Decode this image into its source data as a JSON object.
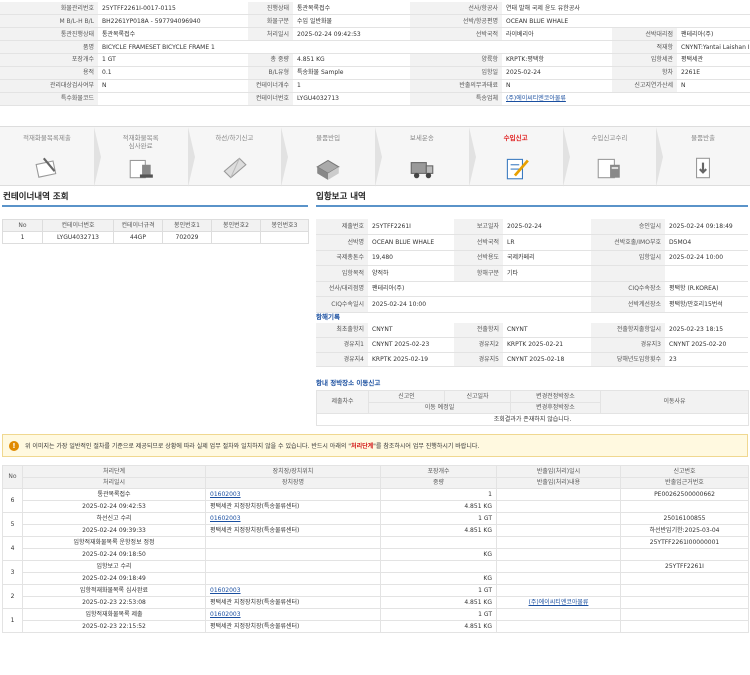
{
  "info": [
    [
      [
        "화물관리번호",
        "25YTFF2261I-0017-0115"
      ],
      [
        "진행상태",
        "통관목록접수"
      ],
      [
        "선사/항공사",
        "연태 발해 국제 윤도 유한공사"
      ]
    ],
    [
      [
        "M B/L-H B/L",
        "BH2261YP018A - 597794096940"
      ],
      [
        "화물구분",
        "수입 일반화물"
      ],
      [
        "선박/항공편명",
        "OCEAN BLUE WHALE"
      ]
    ],
    [
      [
        "통관진행상태",
        "통관목록접수"
      ],
      [
        "처리일시",
        "2025-02-24 09:42:53"
      ],
      [
        "선박국적",
        "라이베리아"
      ],
      [
        "선박대리점",
        "팬테리아(주)"
      ]
    ],
    [
      [
        "품명",
        "BICYCLE FRAMESET BICYCLE FRAME 1"
      ],
      [
        "적재항",
        "CNYNT:Yantai Laishan International Apt, CN"
      ]
    ],
    [
      [
        "포장개수",
        "1 GT"
      ],
      [
        "총 중량",
        "4.851 KG"
      ],
      [
        "양륙항",
        "KRPTK:평택항"
      ],
      [
        "입항세관",
        "평택세관"
      ]
    ],
    [
      [
        "용적",
        "0.1"
      ],
      [
        "B/L유형",
        "특송화물 Sample"
      ],
      [
        "입항일",
        "2025-02-24"
      ],
      [
        "항차",
        "2261E"
      ]
    ],
    [
      [
        "관리대상검사여부",
        "N"
      ],
      [
        "컨테이너개수",
        "1"
      ],
      [
        "반출의무과태료",
        "N"
      ],
      [
        "신고지연가산세",
        "N"
      ]
    ],
    [
      [
        "특수화물코드",
        ""
      ],
      [
        "컨테이너번호",
        "LYGU4032713"
      ],
      [
        "특송업체",
        "(주)에이씨티엔코아물류"
      ]
    ]
  ],
  "steps": [
    {
      "label": "적재화물목록제출",
      "icon": "document-pen-icon",
      "active": false
    },
    {
      "label": "적재화물목록\n심사완료",
      "icon": "review-stamp-icon",
      "active": false
    },
    {
      "label": "하선/하기신고",
      "icon": "unloading-icon",
      "active": false
    },
    {
      "label": "물품반입",
      "icon": "warehouse-in-icon",
      "active": false
    },
    {
      "label": "보세운송",
      "icon": "truck-icon",
      "active": false
    },
    {
      "label": "수입신고",
      "icon": "declaration-icon",
      "active": true
    },
    {
      "label": "수입신고수리",
      "icon": "calculator-icon",
      "active": false
    },
    {
      "label": "물품반출",
      "icon": "release-icon",
      "active": false
    }
  ],
  "container": {
    "title": "컨테이너내역 조회",
    "headers": [
      "No",
      "컨테이너번호",
      "컨테이너규격",
      "봉인번호1",
      "봉인번호2",
      "봉인번호3"
    ],
    "rows": [
      [
        "1",
        "LYGU4032713",
        "44GP",
        "702029",
        "",
        ""
      ]
    ]
  },
  "report": {
    "title": "입항보고 내역",
    "rows": [
      [
        [
          "제출번호",
          "25YTFF2261I"
        ],
        [
          "보고일자",
          "2025-02-24"
        ],
        [
          "승인일시",
          "2025-02-24 09:18:49"
        ]
      ],
      [
        [
          "선박명",
          "OCEAN BLUE WHALE"
        ],
        [
          "선박국적",
          "LR"
        ],
        [
          "선박호출/IMO부호",
          "D5MO4"
        ]
      ],
      [
        [
          "국제총톤수",
          "19,480"
        ],
        [
          "선박용도",
          "국제카페리"
        ],
        [
          "입항일시",
          "2025-02-24 10:00"
        ]
      ],
      [
        [
          "입항목적",
          "양적하"
        ],
        [
          "항해구분",
          "기타"
        ],
        [
          "",
          ""
        ]
      ],
      [
        [
          "선사/대리점명",
          "팬테리아(주)"
        ],
        [
          "CIQ수속장소",
          "평택항 (R.KOREA)"
        ]
      ],
      [
        [
          "CIQ수속일시",
          "2025-02-24 10:00"
        ],
        [
          "선박계선장소",
          "평택항/만호리15번석"
        ]
      ]
    ]
  },
  "voyage": {
    "title": "항해기록",
    "rows": [
      [
        [
          "최초출항지",
          "CNYNT"
        ],
        [
          "전출항지",
          "CNYNT"
        ],
        [
          "전출항지출항일시",
          "2025-02-23 18:15"
        ]
      ],
      [
        [
          "경유지1",
          "CNYNT 2025-02-23"
        ],
        [
          "경유지2",
          "KRPTK 2025-02-21"
        ],
        [
          "경유지3",
          "CNYNT 2025-02-20"
        ]
      ],
      [
        [
          "경유지4",
          "KRPTK 2025-02-19"
        ],
        [
          "경유지5",
          "CNYNT 2025-02-18"
        ],
        [
          "당해년도입항횟수",
          "23"
        ]
      ]
    ]
  },
  "transfer": {
    "title": "항내 정박장소 이동신고",
    "h_submit": "제출차수",
    "h_applicant": "신고인",
    "h_date": "신고일자",
    "h_before": "변경전정박장소",
    "h_reason": "이동사유",
    "h_scheduled": "이동 예정일",
    "h_after": "변경후정박장소",
    "empty": "조회결과가 존재하지 않습니다."
  },
  "warning": {
    "pre": "위 이미지는 가장 일반적인 절차를 기준으로 제공되므로 상황에 따라 실제 업무 절차와 일치하지 않을 수 있습니다. 반드시 아래의 \"",
    "highlight": "처리단계",
    "post": "\"를 참조하시어 업무 진행하시기 바랍니다."
  },
  "history": {
    "headers": {
      "no": "No",
      "step": "처리단계",
      "date": "처리일시",
      "place": "장치장/장치위치",
      "placename": "장치장명",
      "pkg": "포장개수",
      "weight": "중량",
      "io": "반출입(처리)일시",
      "iocontent": "반출입(처리)내용",
      "decl": "신고번호",
      "basis": "반출입근거번호"
    },
    "rows": [
      {
        "no": "6",
        "step": "통관목록접수",
        "date": "2025-02-24 09:42:53",
        "place": "01602003",
        "placename": "평택세관 지정장치장(특송물류센터)",
        "pkg": "1",
        "weight": "4.851 KG",
        "io": "",
        "iocontent": "",
        "decl": "PE00262500000662",
        "basis": ""
      },
      {
        "no": "5",
        "step": "하선신고 수리",
        "date": "2025-02-24 09:39:33",
        "place": "01602003",
        "placename": "평택세관 지정장치장(특송물류센터)",
        "pkg": "1 GT",
        "weight": "4.851 KG",
        "io": "",
        "iocontent": "",
        "decl": "25016100855",
        "basis": "하선반입기한:2025-03-04"
      },
      {
        "no": "4",
        "step": "입항적재화물목록 운항정보 정정",
        "date": "2025-02-24 09:18:50",
        "place": "",
        "placename": "",
        "pkg": "",
        "weight": "KG",
        "io": "",
        "iocontent": "",
        "decl": "25YTFF2261I00000001",
        "basis": ""
      },
      {
        "no": "3",
        "step": "입항보고 수리",
        "date": "2025-02-24 09:18:49",
        "place": "",
        "placename": "",
        "pkg": "",
        "weight": "KG",
        "io": "",
        "iocontent": "",
        "decl": "25YTFF2261I",
        "basis": ""
      },
      {
        "no": "2",
        "step": "입항적재화물목록 심사완료",
        "date": "2025-02-23 22:53:08",
        "place": "01602003",
        "placename": "평택세관 지정장치장(특송물류센터)",
        "pkg": "1 GT",
        "weight": "4.851 KG",
        "io": "",
        "iocontent": "(주)에이씨티엔코아물류",
        "decl": "",
        "basis": ""
      },
      {
        "no": "1",
        "step": "입항적재화물목록 제출",
        "date": "2025-02-23 22:15:52",
        "place": "01602003",
        "placename": "평택세관 지정장치장(특송물류센터)",
        "pkg": "1 GT",
        "weight": "4.851 KG",
        "io": "",
        "iocontent": "",
        "decl": "",
        "basis": ""
      }
    ]
  },
  "colors": {
    "accent": "#5a93c9",
    "link": "#1a4fa0",
    "active": "#e02020",
    "warn": "#e08a00"
  }
}
